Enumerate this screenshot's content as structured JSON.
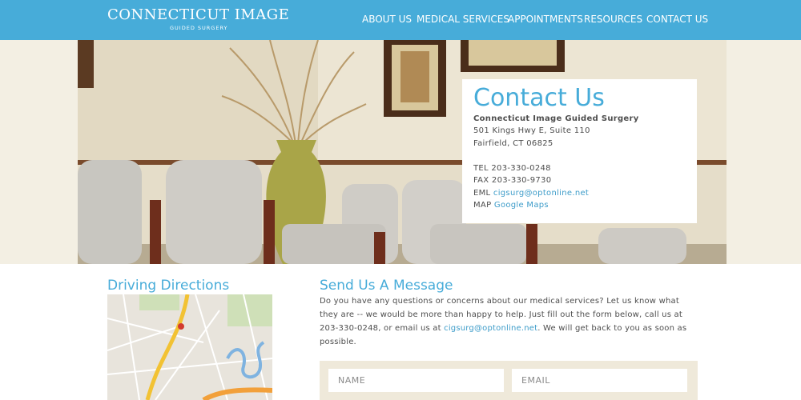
{
  "header": {
    "logo_main": "CONNECTICUT IMAGE",
    "logo_sub": "GUIDED SURGERY",
    "nav": [
      "ABOUT US",
      "MEDICAL SERVICES",
      "APPOINTMENTS",
      "RESOURCES",
      "CONTACT US"
    ]
  },
  "contact": {
    "title": "Contact Us",
    "org": "Connecticut Image Guided Surgery",
    "address1": "501 Kings Hwy E, Suite 110",
    "address2": "Fairfield, CT 06825",
    "tel_label": "TEL",
    "tel": "203-330-0248",
    "fax_label": "FAX",
    "fax": "203-330-9730",
    "eml_label": "EML",
    "email": "cigsurg@optonline.net",
    "map_label": "MAP",
    "map_link": "Google Maps"
  },
  "directions": {
    "title": "Driving Directions"
  },
  "message": {
    "title": "Send Us A Message",
    "body_before": "Do you have any questions or concerns about our medical services? Let us know what they are -- we would be more than happy to help. Just fill out the form below, call us at 203-330-0248, or email us at ",
    "email": "cigsurg@optonline.net",
    "body_after": ". We will get back to you as soon as possible."
  },
  "form": {
    "name_placeholder": "NAME",
    "email_placeholder": "EMAIL"
  },
  "colors": {
    "accent": "#47acd9",
    "link": "#3d9cc9",
    "form_bg": "#efe9da"
  }
}
